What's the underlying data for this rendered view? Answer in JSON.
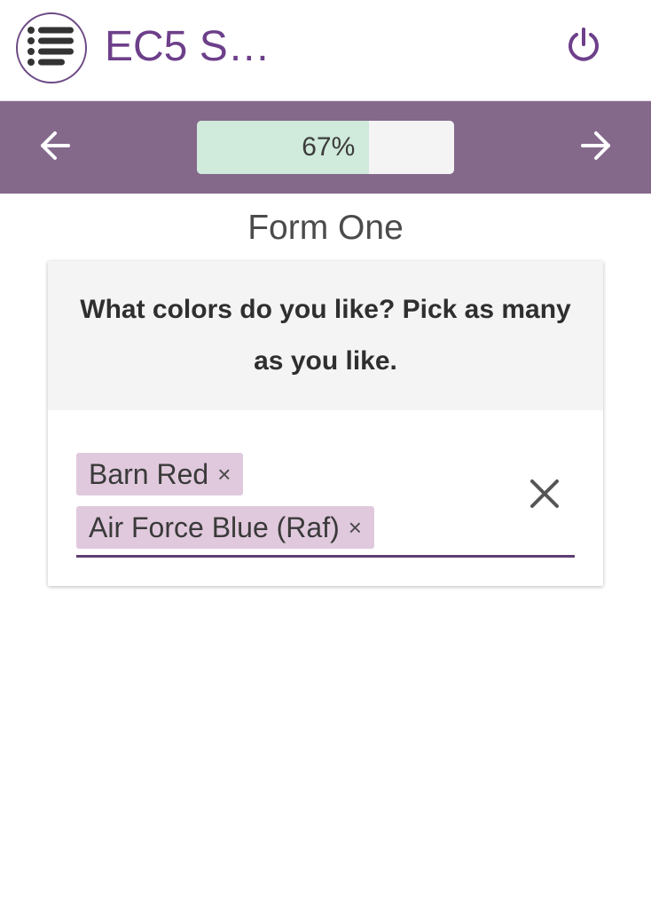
{
  "header": {
    "title": "EC5 S…",
    "menu_icon": "list-icon",
    "power_icon": "power-icon",
    "accent_color": "#6d3f8a"
  },
  "navbar": {
    "background": "#84698b",
    "prev_icon": "arrow-left-icon",
    "next_icon": "arrow-right-icon",
    "progress": {
      "percent": 67,
      "label": "67%"
    }
  },
  "form": {
    "title": "Form One",
    "question": "What colors do you like? Pick as many as you like.",
    "selected": [
      {
        "label": "Barn Red",
        "remove": "×"
      },
      {
        "label": "Air Force Blue (Raf)",
        "remove": "×"
      }
    ],
    "clear_icon": "close-icon"
  }
}
